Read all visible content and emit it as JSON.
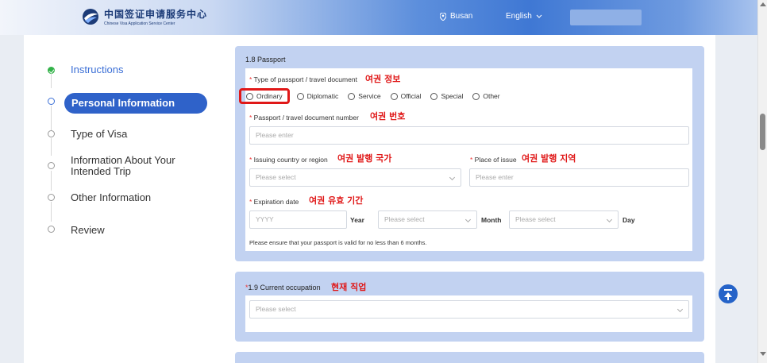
{
  "header": {
    "logo_cn": "中国签证申请服务中心",
    "logo_en": "Chinese Visa Application Service Center",
    "location": "Busan",
    "language": "English"
  },
  "sidebar": {
    "steps": [
      {
        "label": "Instructions",
        "state": "done"
      },
      {
        "label": "Personal Information",
        "state": "active"
      },
      {
        "label": "Type of Visa",
        "state": "pending"
      },
      {
        "label": "Information About Your Intended Trip",
        "state": "pending"
      },
      {
        "label": "Other Information",
        "state": "pending"
      },
      {
        "label": "Review",
        "state": "pending"
      }
    ]
  },
  "passport": {
    "title": "1.8 Passport",
    "type_label": "Type of passport / travel document",
    "type_annotation": "여권 정보",
    "types": [
      "Ordinary",
      "Diplomatic",
      "Service",
      "Official",
      "Special",
      "Other"
    ],
    "number_label": "Passport / travel document number",
    "number_annotation": "여권 번호",
    "number_placeholder": "Please enter",
    "country_label": "Issuing country or region",
    "country_annotation": "여권 발행 국가",
    "country_placeholder": "Please select",
    "place_label": "Place of issue",
    "place_annotation": "여권 발행 지역",
    "place_placeholder": "Please enter",
    "expiry_label": "Expiration date",
    "expiry_annotation": "여권 유효 기간",
    "year_placeholder": "YYYY",
    "year_unit": "Year",
    "month_placeholder": "Please select",
    "month_unit": "Month",
    "day_placeholder": "Please select",
    "day_unit": "Day",
    "note": "Please ensure that your passport is valid for no less than 6 months."
  },
  "occupation": {
    "title": "1.9 Current occupation",
    "annotation": "현재 직업",
    "placeholder": "Please select"
  },
  "colors": {
    "accent": "#2f62c9",
    "section_bg": "#c2d2f1",
    "annotation": "#e01818",
    "done": "#33b249"
  }
}
